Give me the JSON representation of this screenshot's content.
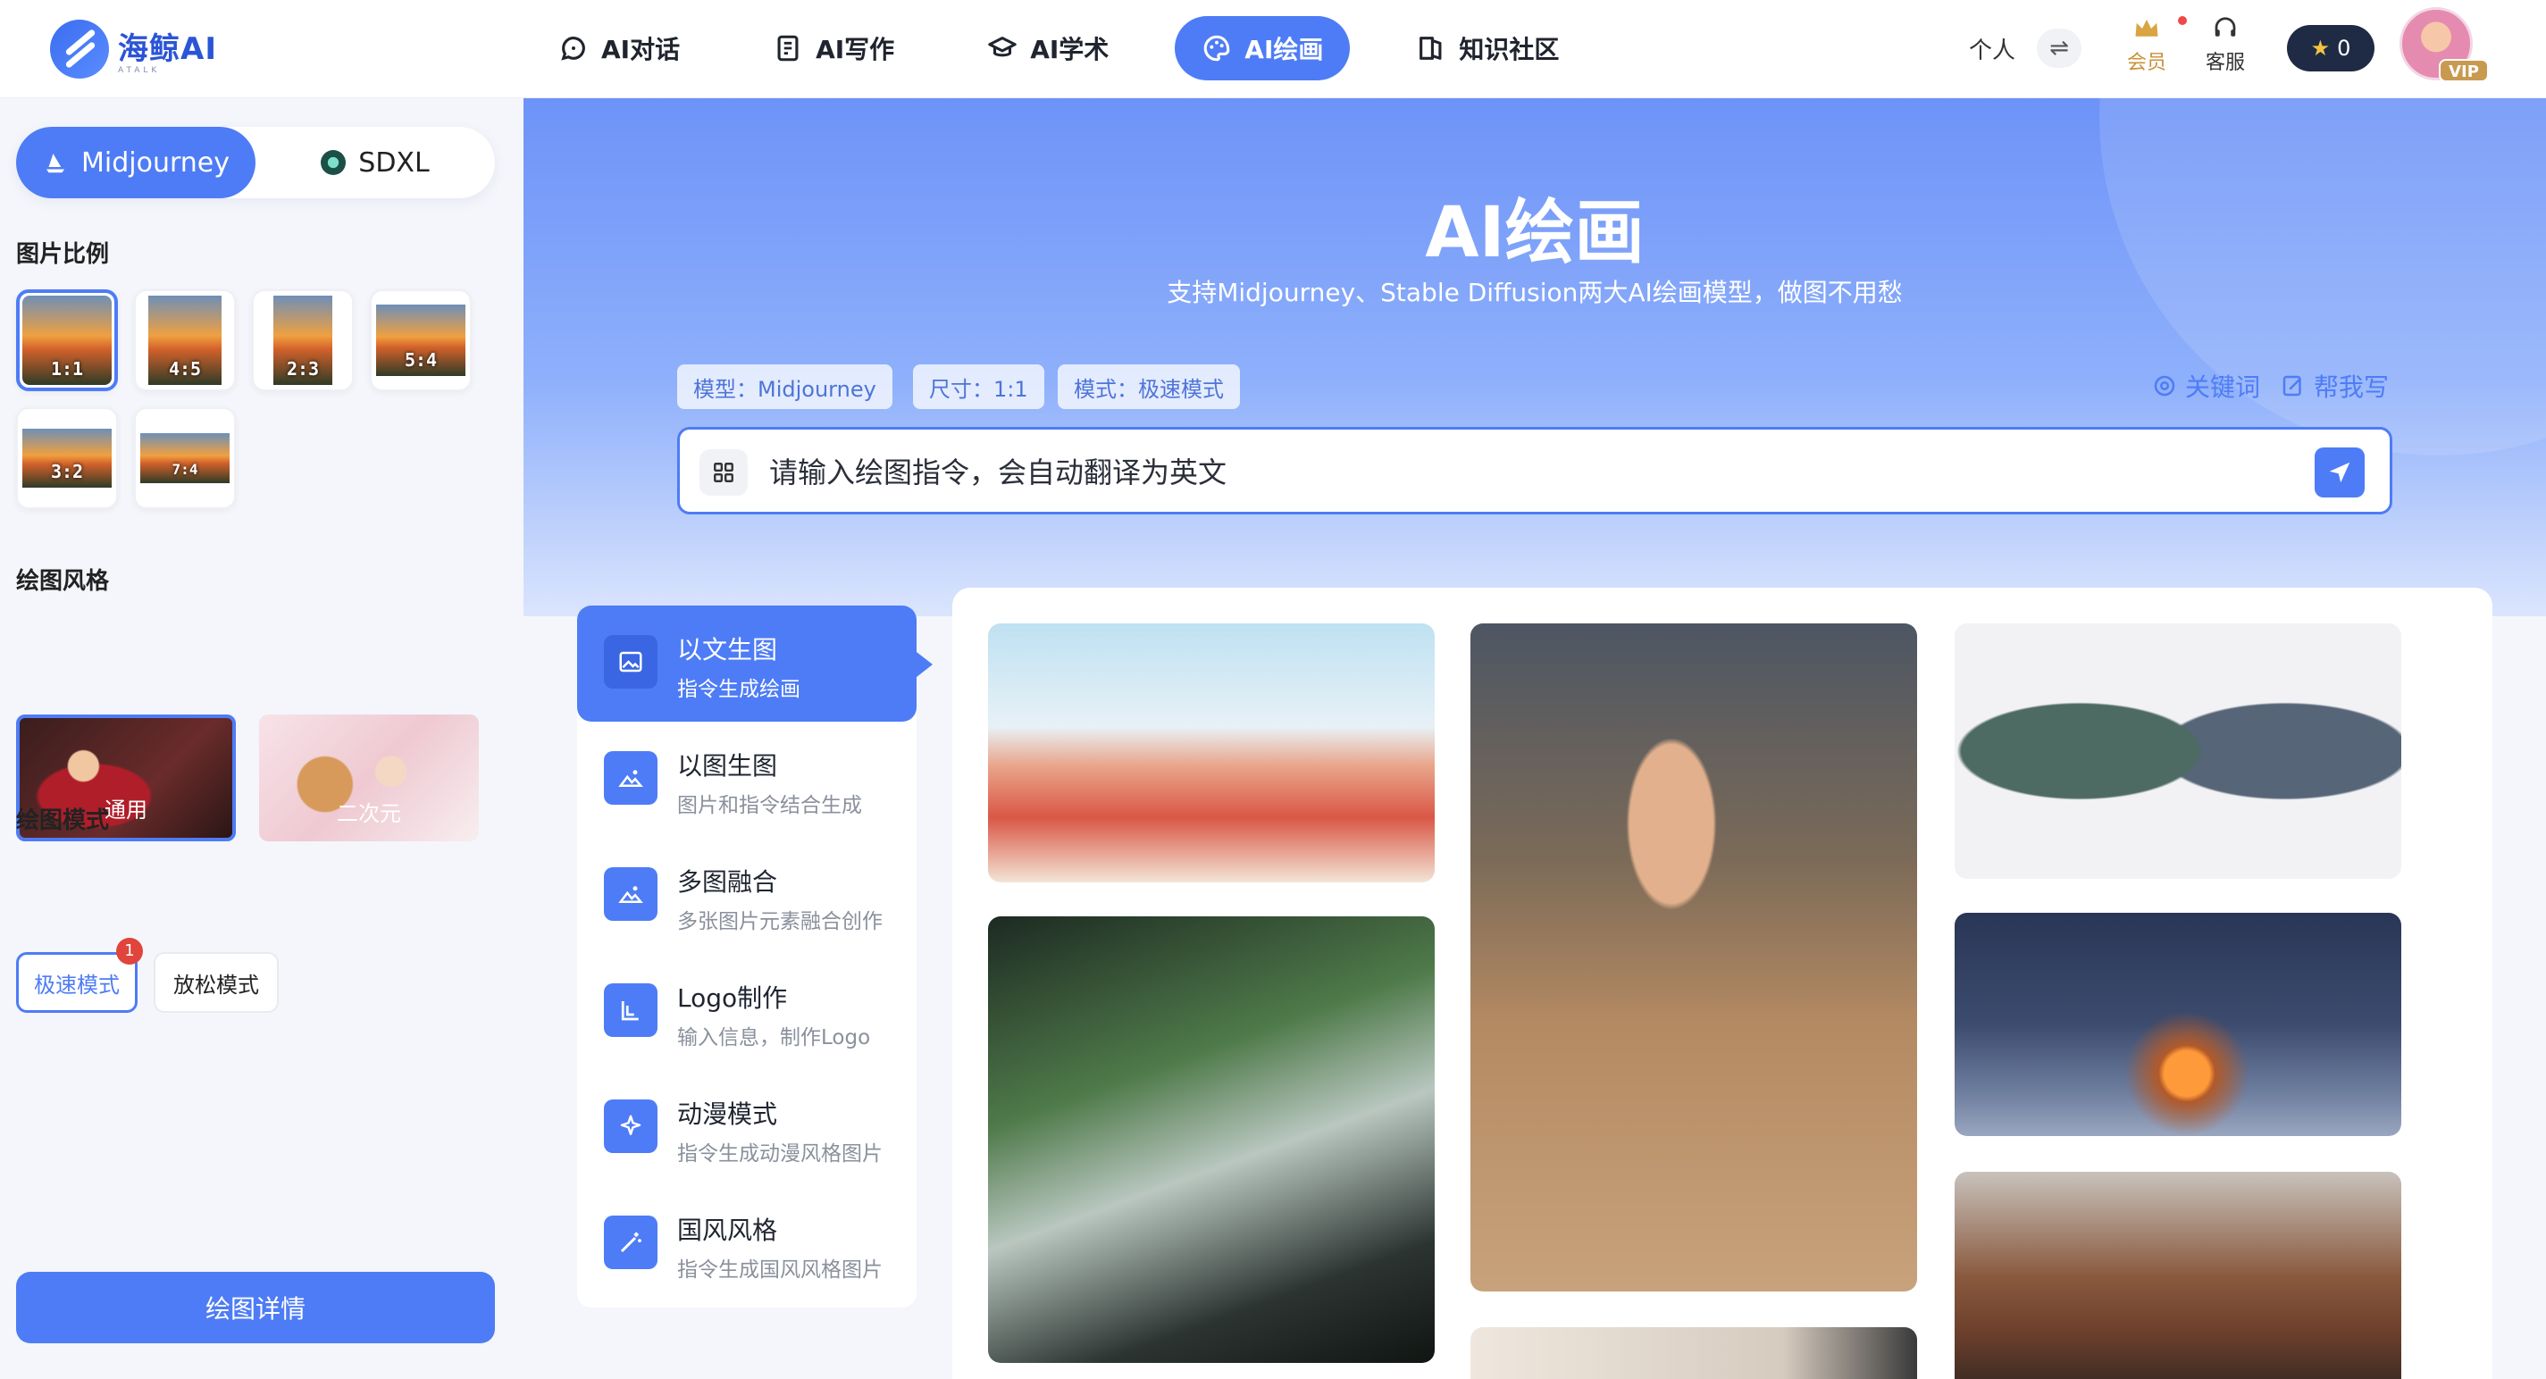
{
  "brand": {
    "name": "海鲸AI",
    "sub": "ATALK"
  },
  "nav": [
    {
      "label": "AI对话",
      "icon": "chat-icon"
    },
    {
      "label": "AI写作",
      "icon": "document-icon"
    },
    {
      "label": "AI学术",
      "icon": "graduation-cap-icon"
    },
    {
      "label": "AI绘画",
      "icon": "palette-icon",
      "active": true
    },
    {
      "label": "知识社区",
      "icon": "book-icon"
    }
  ],
  "toolbar": {
    "personal": "个人",
    "switch": "⇌",
    "member": "会员",
    "service": "客服",
    "coins": "0",
    "vip": "VIP"
  },
  "sidebar": {
    "models": [
      {
        "label": "Midjourney",
        "active": true
      },
      {
        "label": "SDXL",
        "active": false
      }
    ],
    "ratio_title": "图片比例",
    "ratios": [
      "1:1",
      "4:5",
      "2:3",
      "5:4",
      "3:2",
      "7:4"
    ],
    "style_title": "绘图风格",
    "styles": [
      {
        "label": "通用",
        "active": true
      },
      {
        "label": "二次元",
        "active": false
      }
    ],
    "mode_title": "绘图模式",
    "modes": [
      {
        "label": "极速模式",
        "active": true
      },
      {
        "label": "放松模式",
        "active": false
      }
    ],
    "mode_badge": "1",
    "detail_button": "绘图详情"
  },
  "hero": {
    "title": "AI绘画",
    "subtitle": "支持Midjourney、Stable Diffusion两大AI绘画模型，做图不用愁",
    "chips": [
      "模型：Midjourney",
      "尺寸：1:1",
      "模式：极速模式"
    ],
    "keyword_link": "关键词",
    "help_link": "帮我写",
    "prompt_placeholder": "请输入绘图指令，会自动翻译为英文"
  },
  "draw_modes": [
    {
      "title": "以文生图",
      "desc": "指令生成绘画",
      "icon": "image-icon",
      "active": true
    },
    {
      "title": "以图生图",
      "desc": "图片和指令结合生成",
      "icon": "landscape-icon"
    },
    {
      "title": "多图融合",
      "desc": "多张图片元素融合创作",
      "icon": "landscape-icon"
    },
    {
      "title": "Logo制作",
      "desc": "输入信息，制作Logo",
      "icon": "logo-icon"
    },
    {
      "title": "动漫模式",
      "desc": "指令生成动漫风格图片",
      "icon": "sparkle-icon"
    },
    {
      "title": "国风风格",
      "desc": "指令生成国风风格图片",
      "icon": "magic-wand-icon"
    }
  ],
  "colors": {
    "accent": "#4e7cf6",
    "dark": "#1f2b44"
  }
}
